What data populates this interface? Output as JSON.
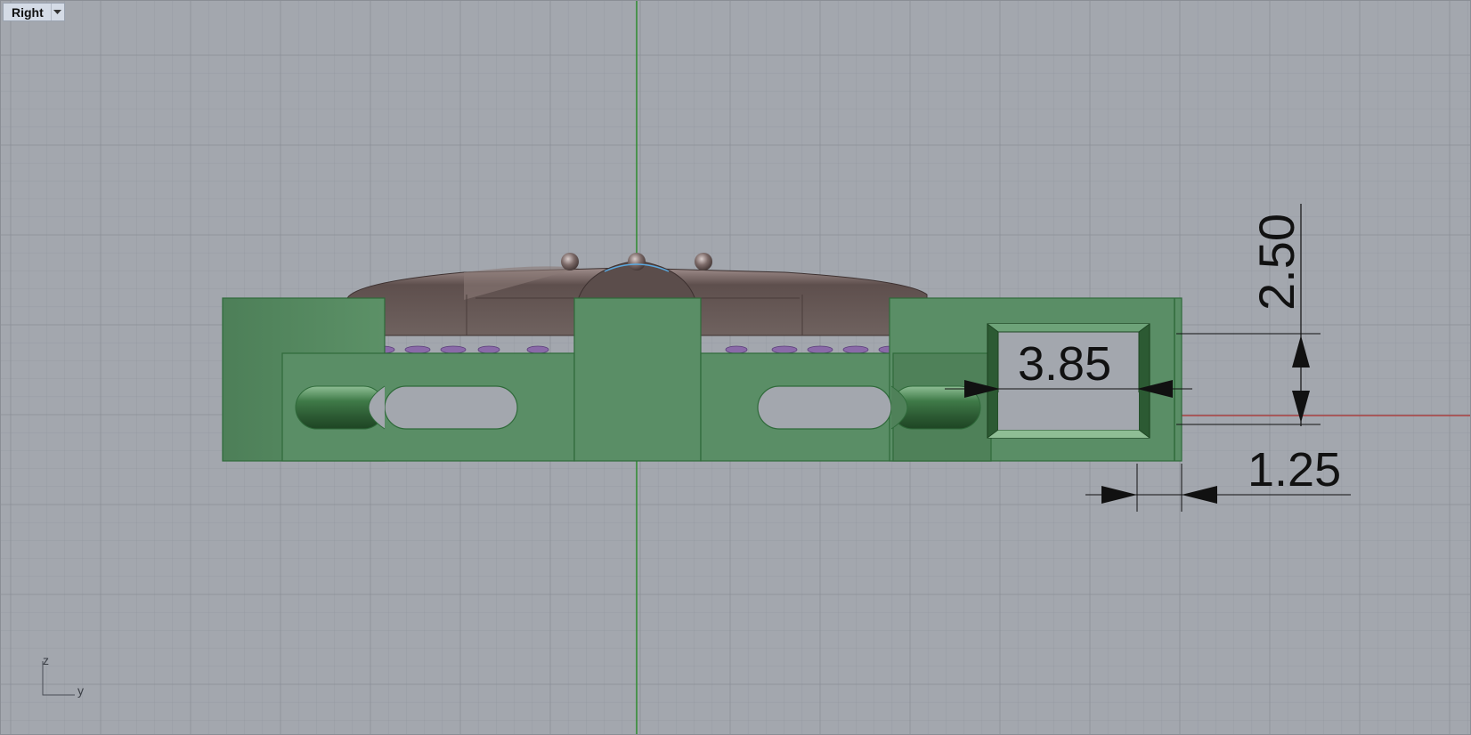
{
  "viewport": {
    "view_name": "Right",
    "view_menu_icon": "chevron-down-icon",
    "background_color": "#a3a7ae",
    "grid_color": "#8e939b",
    "z_axis_color": "#2e8b2e",
    "y_axis_color": "#b03030"
  },
  "dimensions": {
    "height_top": "2.50",
    "slot_width": "3.85",
    "wall_thickness": "1.25"
  },
  "axis_triad": {
    "z_label": "z",
    "y_label": "y"
  },
  "model": {
    "frame_color": "#5a8e66",
    "frame_edge_color": "#2f6a3a",
    "dome_color": "#6e5f5d",
    "gem_color": "#8a6aa8"
  }
}
